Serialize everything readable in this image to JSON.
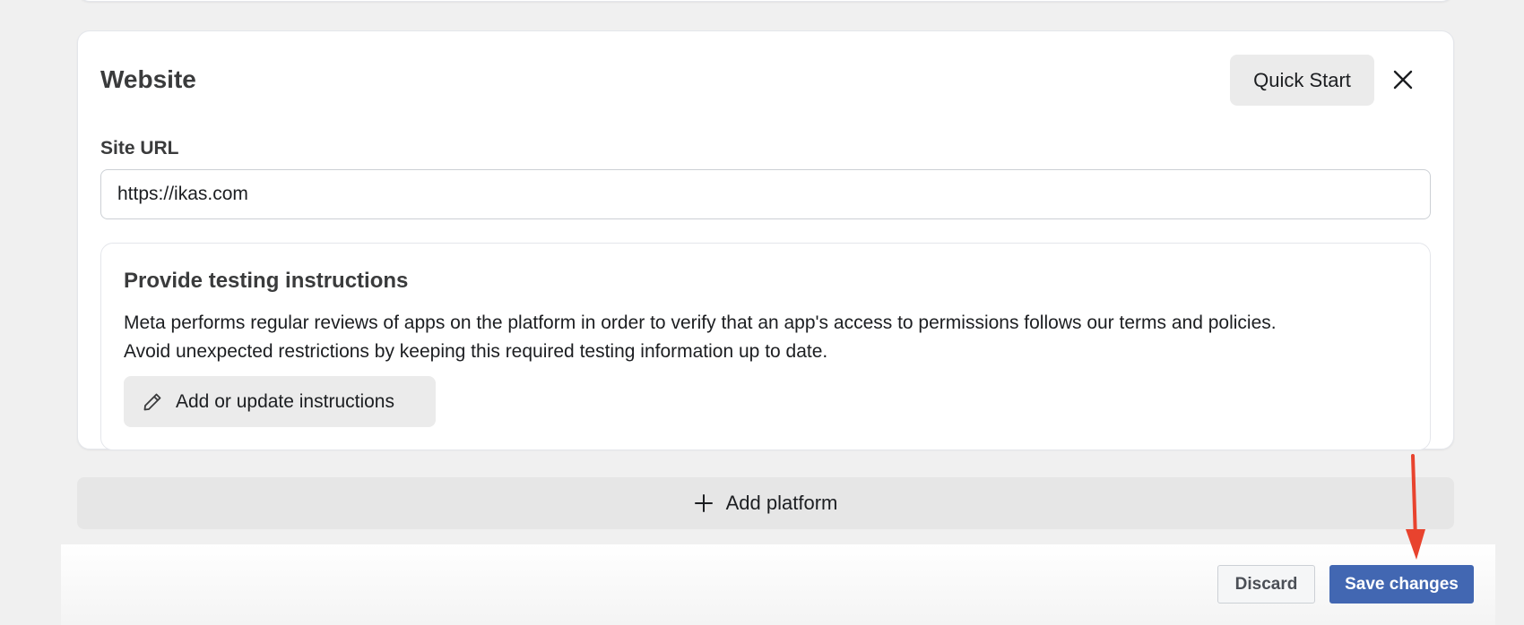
{
  "website_card": {
    "title": "Website",
    "quick_start_label": "Quick Start",
    "site_url": {
      "label": "Site URL",
      "value": "https://ikas.com"
    },
    "testing": {
      "title": "Provide testing instructions",
      "line1": "Meta performs regular reviews of apps on the platform in order to verify that an app's access to permissions follows our terms and policies.",
      "line2": "Avoid unexpected restrictions by keeping this required testing information up to date.",
      "button_label": "Add or update instructions"
    }
  },
  "add_platform_label": "Add platform",
  "footer": {
    "discard_label": "Discard",
    "save_label": "Save changes"
  },
  "colors": {
    "primary": "#4267b2",
    "annotation_arrow": "#e8432e"
  },
  "icons": [
    "close-icon",
    "pencil-icon",
    "plus-icon"
  ]
}
